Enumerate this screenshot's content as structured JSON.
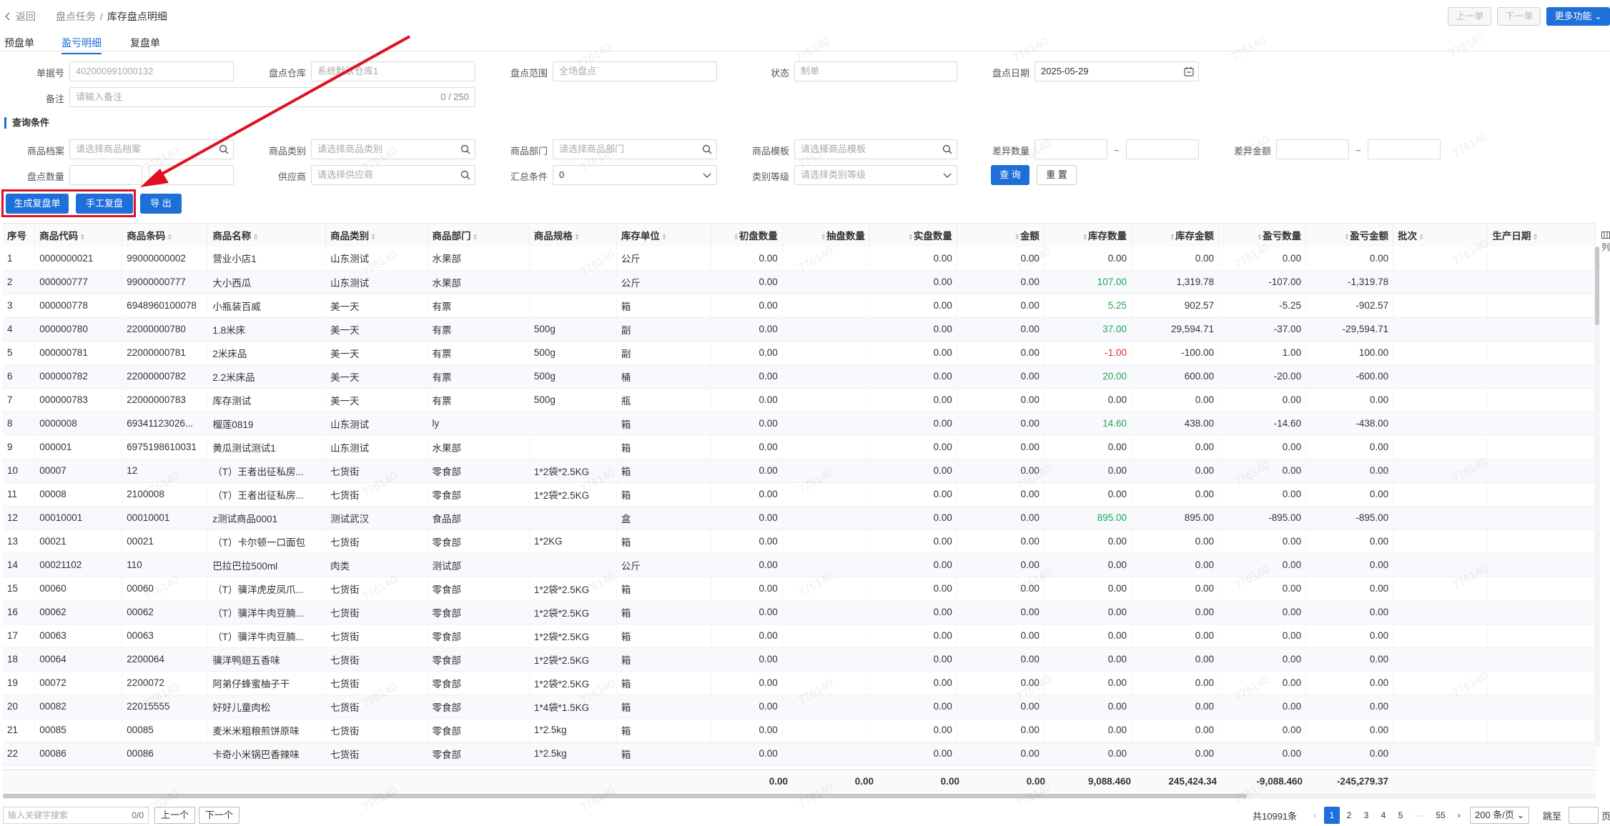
{
  "header": {
    "back_label": "返回",
    "crumb_parent": "盘点任务",
    "crumb_current": "库存盘点明细",
    "prev_label": "上一单",
    "next_label": "下一单",
    "more_label": "更多功能"
  },
  "tabs": [
    "预盘单",
    "盈亏明细",
    "复盘单"
  ],
  "form": {
    "order_no_label": "单据号",
    "order_no": "402000991000132",
    "warehouse_label": "盘点仓库",
    "warehouse": "系统默认仓库1",
    "range_label": "盘点范围",
    "range": "全场盘点",
    "status_label": "状态",
    "status": "制单",
    "date_label": "盘点日期",
    "date": "2025-05-29",
    "remark_label": "备注",
    "remark_placeholder": "请输入备注",
    "remark_count": "0 / 250"
  },
  "query": {
    "title": "查询条件",
    "goods_label": "商品档案",
    "goods_ph": "请选择商品档案",
    "category_label": "商品类别",
    "category_ph": "请选择商品类别",
    "dept_label": "商品部门",
    "dept_ph": "请选择商品部门",
    "template_label": "商品模板",
    "template_ph": "请选择商品模板",
    "diff_qty_label": "差异数量",
    "diff_amt_label": "差异金额",
    "tilde": "~",
    "count_qty_label": "盘点数量",
    "supplier_label": "供应商",
    "supplier_ph": "请选择供应商",
    "summary_label": "汇总条件",
    "summary_val": "0",
    "level_label": "类别等级",
    "level_ph": "请选择类别等级",
    "search_btn": "查 询",
    "reset_btn": "重 置"
  },
  "actions": {
    "gen": "生成复盘单",
    "manual": "手工复盘",
    "export": "导 出"
  },
  "columns": [
    "序号",
    "商品代码",
    "商品条码",
    "商品名称",
    "商品类别",
    "商品部门",
    "商品规格",
    "库存单位",
    "初盘数量",
    "抽盘数量",
    "实盘数量",
    "金额",
    "库存数量",
    "库存金额",
    "盈亏数量",
    "盈亏金额",
    "批次",
    "生产日期"
  ],
  "rows": [
    [
      "1",
      "0000000021",
      "99000000002",
      "营业小店1",
      "山东测试",
      "水果部",
      "",
      "公斤",
      "0.00",
      "",
      "0.00",
      "0.00",
      "0.00",
      "0.00",
      "0.00",
      "0.00"
    ],
    [
      "2",
      "000000777",
      "99000000777",
      "大小西瓜",
      "山东测试",
      "水果部",
      "",
      "公斤",
      "0.00",
      "",
      "0.00",
      "0.00",
      "107.00",
      "1,319.78",
      "-107.00",
      "-1,319.78"
    ],
    [
      "3",
      "000000778",
      "6948960100078",
      "小瓶装百威",
      "美一天",
      "有票",
      "",
      "箱",
      "0.00",
      "",
      "0.00",
      "0.00",
      "5.25",
      "902.57",
      "-5.25",
      "-902.57"
    ],
    [
      "4",
      "000000780",
      "22000000780",
      "1.8米床",
      "美一天",
      "有票",
      "500g",
      "副",
      "0.00",
      "",
      "0.00",
      "0.00",
      "37.00",
      "29,594.71",
      "-37.00",
      "-29,594.71"
    ],
    [
      "5",
      "000000781",
      "22000000781",
      "2米床品",
      "美一天",
      "有票",
      "500g",
      "副",
      "0.00",
      "",
      "0.00",
      "0.00",
      "-1.00",
      "-100.00",
      "1.00",
      "100.00"
    ],
    [
      "6",
      "000000782",
      "22000000782",
      "2.2米床品",
      "美一天",
      "有票",
      "500g",
      "桶",
      "0.00",
      "",
      "0.00",
      "0.00",
      "20.00",
      "600.00",
      "-20.00",
      "-600.00"
    ],
    [
      "7",
      "000000783",
      "22000000783",
      "库存测试",
      "美一天",
      "有票",
      "500g",
      "瓶",
      "0.00",
      "",
      "0.00",
      "0.00",
      "0.00",
      "0.00",
      "0.00",
      "0.00"
    ],
    [
      "8",
      "0000008",
      "69341123026...",
      "榴莲0819",
      "山东测试",
      "ly",
      "",
      "箱",
      "0.00",
      "",
      "0.00",
      "0.00",
      "14.60",
      "438.00",
      "-14.60",
      "-438.00"
    ],
    [
      "9",
      "000001",
      "6975198610031",
      "黄瓜测试测试1",
      "山东测试",
      "水果部",
      "",
      "箱",
      "0.00",
      "",
      "0.00",
      "0.00",
      "0.00",
      "0.00",
      "0.00",
      "0.00"
    ],
    [
      "10",
      "00007",
      "12",
      "（T）王者出征私房...",
      "七货街",
      "零食部",
      "1*2袋*2.5KG",
      "箱",
      "0.00",
      "",
      "0.00",
      "0.00",
      "0.00",
      "0.00",
      "0.00",
      "0.00"
    ],
    [
      "11",
      "00008",
      "2100008",
      "（T）王者出征私房...",
      "七货街",
      "零食部",
      "1*2袋*2.5KG",
      "箱",
      "0.00",
      "",
      "0.00",
      "0.00",
      "0.00",
      "0.00",
      "0.00",
      "0.00"
    ],
    [
      "12",
      "00010001",
      "00010001",
      "z测试商品0001",
      "测试武汉",
      "食品部",
      "",
      "盒",
      "0.00",
      "",
      "0.00",
      "0.00",
      "895.00",
      "895.00",
      "-895.00",
      "-895.00"
    ],
    [
      "13",
      "00021",
      "00021",
      "（T）卡尔顿一口面包",
      "七货街",
      "零食部",
      "1*2KG",
      "箱",
      "0.00",
      "",
      "0.00",
      "0.00",
      "0.00",
      "0.00",
      "0.00",
      "0.00"
    ],
    [
      "14",
      "00021102",
      "110",
      "巴拉巴拉500ml",
      "肉类",
      "测试部",
      "",
      "公斤",
      "0.00",
      "",
      "0.00",
      "0.00",
      "0.00",
      "0.00",
      "0.00",
      "0.00"
    ],
    [
      "15",
      "00060",
      "00060",
      "（T）骥洋虎皮凤爪...",
      "七货街",
      "零食部",
      "1*2袋*2.5KG",
      "箱",
      "0.00",
      "",
      "0.00",
      "0.00",
      "0.00",
      "0.00",
      "0.00",
      "0.00"
    ],
    [
      "16",
      "00062",
      "00062",
      "（T）骥洋牛肉豆腩...",
      "七货街",
      "零食部",
      "1*2袋*2.5KG",
      "箱",
      "0.00",
      "",
      "0.00",
      "0.00",
      "0.00",
      "0.00",
      "0.00",
      "0.00"
    ],
    [
      "17",
      "00063",
      "00063",
      "（T）骥洋牛肉豆腩...",
      "七货街",
      "零食部",
      "1*2袋*2.5KG",
      "箱",
      "0.00",
      "",
      "0.00",
      "0.00",
      "0.00",
      "0.00",
      "0.00",
      "0.00"
    ],
    [
      "18",
      "00064",
      "2200064",
      "骥洋鸭翅五香味",
      "七货街",
      "零食部",
      "1*2袋*2.5KG",
      "箱",
      "0.00",
      "",
      "0.00",
      "0.00",
      "0.00",
      "0.00",
      "0.00",
      "0.00"
    ],
    [
      "19",
      "00072",
      "2200072",
      "阿弟仔蜂蜜柚子干",
      "七货街",
      "零食部",
      "1*2袋*2.5KG",
      "箱",
      "0.00",
      "",
      "0.00",
      "0.00",
      "0.00",
      "0.00",
      "0.00",
      "0.00"
    ],
    [
      "20",
      "00082",
      "22015555",
      "好好儿童肉松",
      "七货街",
      "零食部",
      "1*4袋*1.5KG",
      "箱",
      "0.00",
      "",
      "0.00",
      "0.00",
      "0.00",
      "0.00",
      "0.00",
      "0.00"
    ],
    [
      "21",
      "00085",
      "00085",
      "麦米米粗粮煎饼原味",
      "七货街",
      "零食部",
      "1*2.5kg",
      "箱",
      "0.00",
      "",
      "0.00",
      "0.00",
      "0.00",
      "0.00",
      "0.00",
      "0.00"
    ],
    [
      "22",
      "00086",
      "00086",
      "卡奇小米锅巴香辣味",
      "七货街",
      "零食部",
      "1*2.5kg",
      "箱",
      "0.00",
      "",
      "0.00",
      "0.00",
      "0.00",
      "0.00",
      "0.00",
      "0.00"
    ]
  ],
  "totals": {
    "init_qty": "0.00",
    "sample_qty": "0.00",
    "actual_qty": "0.00",
    "amount": "0.00",
    "stock_qty": "9,088.460",
    "stock_amt": "245,424.34",
    "pl_qty": "-9,088.460",
    "pl_amt": "-245,279.37"
  },
  "column_setting": "列",
  "footer": {
    "kw_placeholder": "输入关键字搜索",
    "kw_count": "0/0",
    "prev": "上一个",
    "next": "下一个",
    "total": "共10991条",
    "pages": [
      "1",
      "2",
      "3",
      "4",
      "5",
      "···",
      "55"
    ],
    "page_size": "200 条/页",
    "jump": "跳至",
    "page_suffix": "页"
  },
  "watermark": "776140",
  "colors": {
    "primary": "#1e6fd9",
    "green": "#22a55a",
    "red": "#e02828",
    "highlight": "#e01020"
  }
}
